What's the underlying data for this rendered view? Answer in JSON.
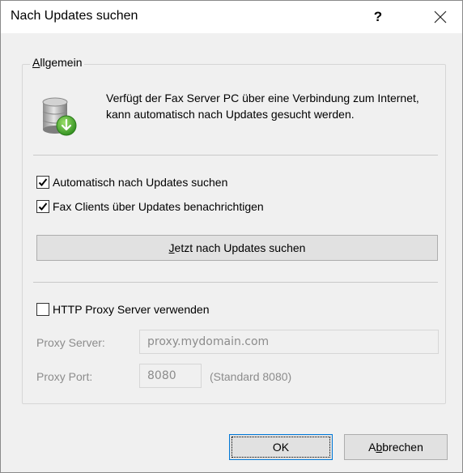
{
  "window": {
    "title": "Nach Updates suchen",
    "help_label": "?"
  },
  "group": {
    "legend_first": "A",
    "legend_rest": "llgemein",
    "description": "Verfügt der Fax Server PC über eine Verbindung zum Internet, kann automatisch nach Updates gesucht werden.",
    "icon": "database-update-icon"
  },
  "options": {
    "auto_update": {
      "label": "Automatisch nach Updates suchen",
      "checked": true
    },
    "notify_clients": {
      "label": "Fax Clients über Updates benachrichtigen",
      "checked": true
    },
    "check_now": {
      "mnemonic": "J",
      "label_rest": "etzt nach Updates suchen"
    }
  },
  "proxy": {
    "use_label": "HTTP Proxy Server verwenden",
    "checked": false,
    "server_label": "Proxy Server:",
    "server_value": "proxy.mydomain.com",
    "port_label": "Proxy Port:",
    "port_value": "8080",
    "port_hint": "(Standard 8080)"
  },
  "footer": {
    "ok_label": "OK",
    "cancel_pre": "A",
    "cancel_mnemonic": "b",
    "cancel_rest": "brechen"
  },
  "colors": {
    "accent": "#0078d7",
    "disabled_text": "#8c8c8c",
    "button_face": "#e1e1e1"
  }
}
